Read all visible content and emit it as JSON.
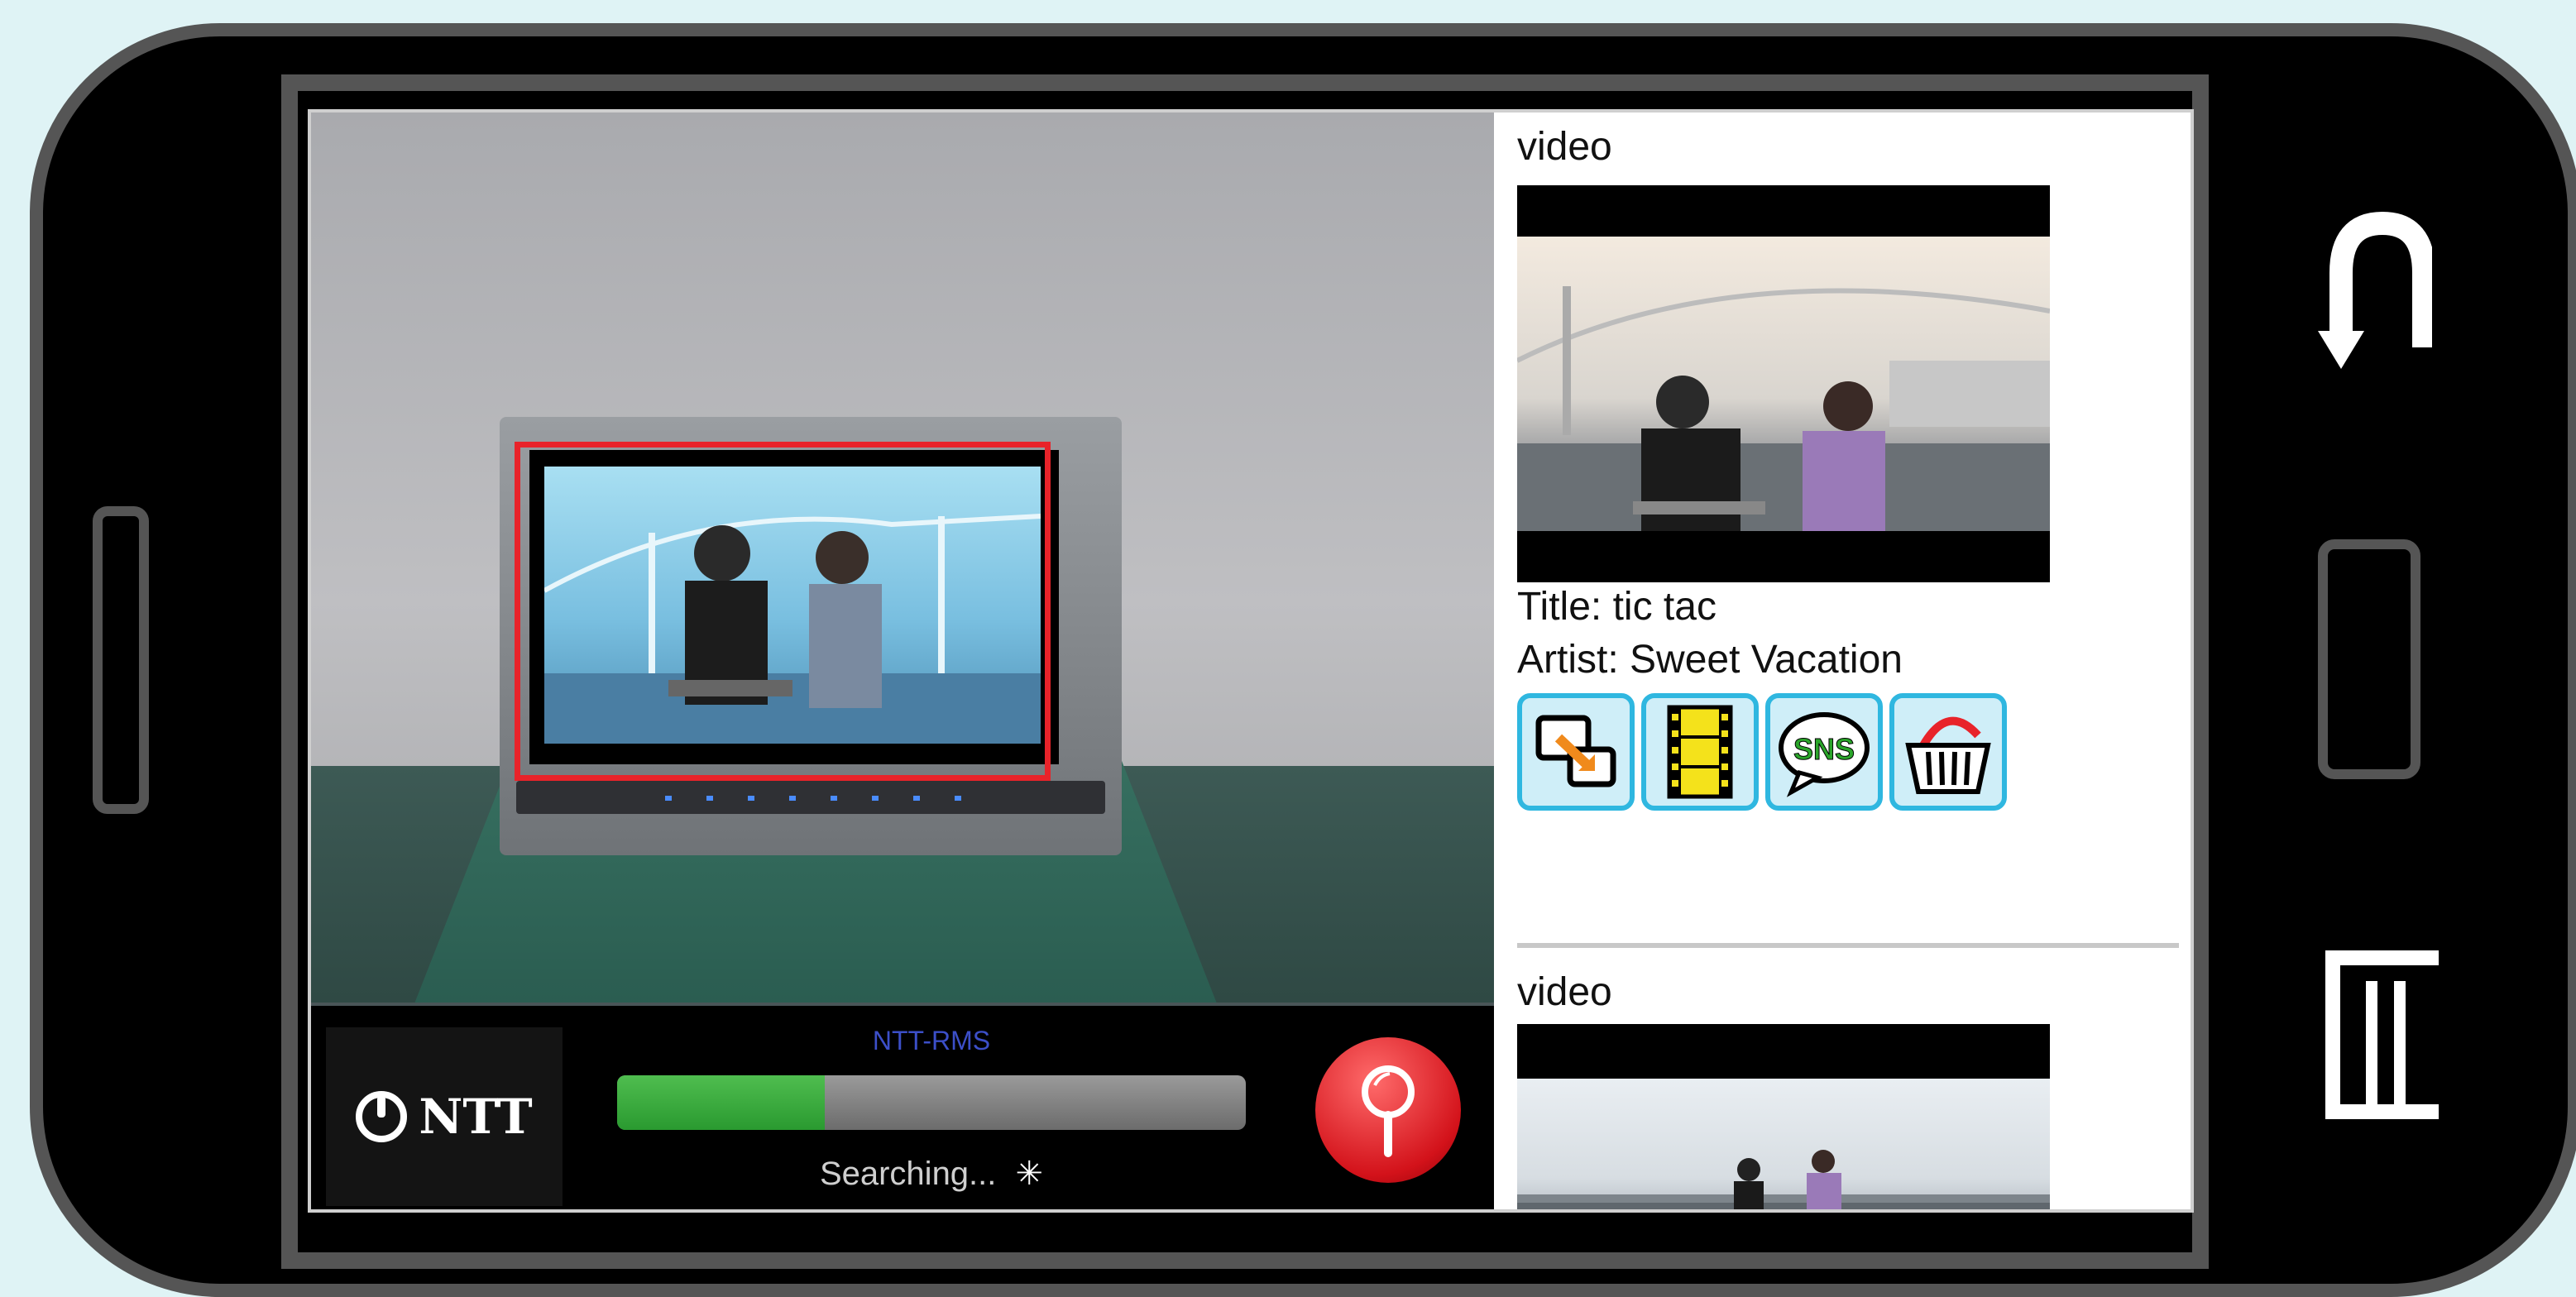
{
  "camera_view": {
    "target_highlight_color": "#e8232a"
  },
  "bottom_bar": {
    "logo_text": "NTT",
    "service_name": "NTT-RMS",
    "progress": 0.33,
    "status_text": "Searching...",
    "search_button_icon": "magnifier-icon"
  },
  "results": [
    {
      "type_label": "video",
      "title_line": "Title: tic tac",
      "artist_line": "Artist: Sweet Vacation",
      "actions": [
        "share-screen-icon",
        "film-icon",
        "sns-icon",
        "shopping-basket-icon"
      ]
    },
    {
      "type_label": "video"
    }
  ],
  "nav": {
    "icons": [
      "back-icon",
      "home-icon",
      "menu-icon"
    ]
  },
  "colors": {
    "frame": "#555555",
    "accent_blue": "#2fb7e0",
    "progress_green": "#2a9a30",
    "search_red": "#d3121a"
  }
}
